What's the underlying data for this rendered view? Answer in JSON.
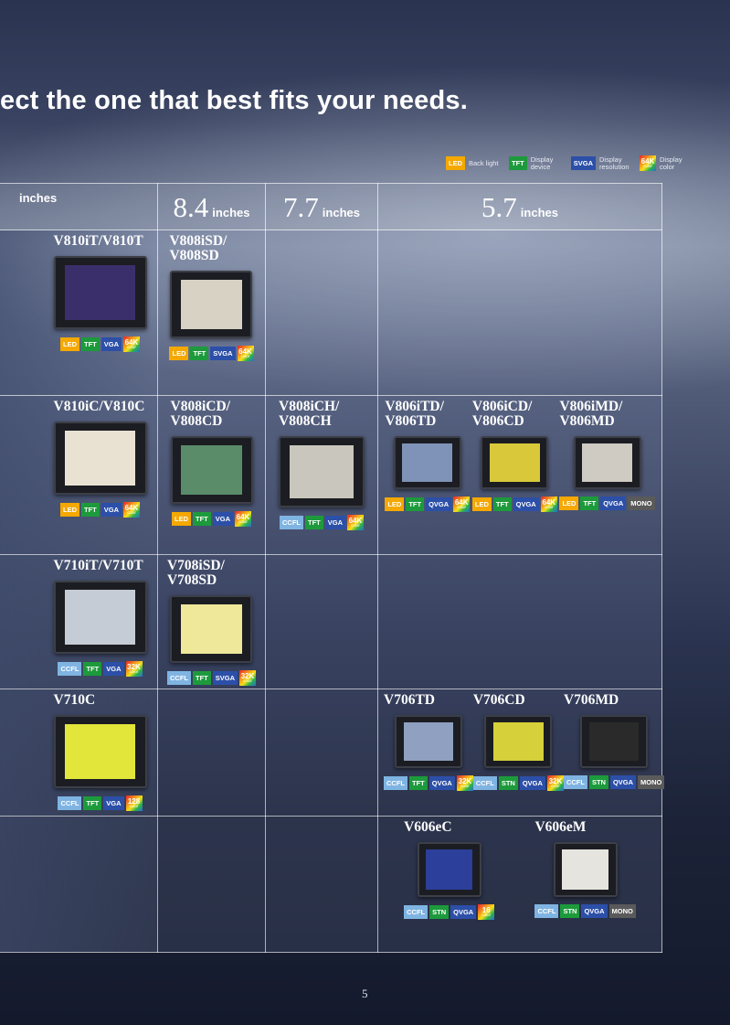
{
  "headline": "ect the one that best fits your needs.",
  "legend": [
    {
      "badge": "LED",
      "label": "Back light",
      "cls": "b-led"
    },
    {
      "badge": "TFT",
      "label": "Display device",
      "cls": "b-tft"
    },
    {
      "badge": "SVGA",
      "label": "Display resolution",
      "cls": "b-res"
    },
    {
      "badge": "64K",
      "sub": "color",
      "label": "Display color",
      "cls": "b-col"
    }
  ],
  "sizes": [
    {
      "num": "",
      "unit": "inches"
    },
    {
      "num": "8.4",
      "unit": "inches"
    },
    {
      "num": "7.7",
      "unit": "inches"
    },
    {
      "num": "5.7",
      "unit": "inches"
    }
  ],
  "rows": [
    {
      "cls": "tall1",
      "cells": [
        [
          {
            "name": "V810iT/V810T",
            "w": 98,
            "h": 76,
            "disp": "#3b2f6b",
            "badges": [
              "LED",
              "TFT",
              "VGA",
              "64K"
            ]
          }
        ],
        [
          {
            "name": "V808iSD/ V808SD",
            "w": 86,
            "h": 70,
            "disp": "#d8d2c4",
            "badges": [
              "LED",
              "TFT",
              "SVGA",
              "64K"
            ]
          }
        ],
        [],
        []
      ]
    },
    {
      "cls": "tall2",
      "cells": [
        [
          {
            "name": "V810iC/V810C",
            "w": 98,
            "h": 76,
            "disp": "#e9e2d3",
            "badges": [
              "LED",
              "TFT",
              "VGA",
              "64K"
            ]
          }
        ],
        [
          {
            "name": "V808iCD/ V808CD",
            "w": 86,
            "h": 70,
            "disp": "#5a8c6a",
            "badges": [
              "LED",
              "TFT",
              "VGA",
              "64K"
            ]
          }
        ],
        [
          {
            "name": "V808iCH/ V808CH",
            "w": 90,
            "h": 74,
            "disp": "#c9c6bd",
            "badges": [
              "CCFL",
              "TFT",
              "VGA",
              "64K"
            ]
          }
        ],
        [
          {
            "name": "V806iTD/ V806TD",
            "w": 70,
            "h": 54,
            "disp": "#7f93b8",
            "badges": [
              "LED",
              "TFT",
              "QVGA",
              "64K"
            ]
          },
          {
            "name": "V806iCD/ V806CD",
            "w": 70,
            "h": 54,
            "disp": "#d8c83a",
            "badges": [
              "LED",
              "TFT",
              "QVGA",
              "64K"
            ]
          },
          {
            "name": "V806iMD/ V806MD",
            "w": 70,
            "h": 54,
            "disp": "#cfcac2",
            "badges": [
              "LED",
              "TFT",
              "QVGA",
              "MONO"
            ]
          }
        ]
      ]
    },
    {
      "cls": "tall3",
      "cells": [
        [
          {
            "name": "V710iT/V710T",
            "w": 98,
            "h": 76,
            "disp": "#c6ccd6",
            "badges": [
              "CCFL",
              "TFT",
              "VGA",
              "32K"
            ]
          }
        ],
        [
          {
            "name": "V708iSD/ V708SD",
            "w": 86,
            "h": 70,
            "disp": "#efe79a",
            "badges": [
              "CCFL",
              "TFT",
              "SVGA",
              "32K"
            ]
          }
        ],
        [],
        []
      ]
    },
    {
      "cls": "tall4",
      "cells": [
        [
          {
            "name": "V710C",
            "w": 98,
            "h": 76,
            "disp": "#e2e63a",
            "badges": [
              "CCFL",
              "TFT",
              "VGA",
              "128"
            ]
          }
        ],
        [],
        [],
        [
          {
            "name": "V706TD",
            "w": 70,
            "h": 54,
            "disp": "#8fa0c0",
            "badges": [
              "CCFL",
              "TFT",
              "QVGA",
              "32K"
            ]
          },
          {
            "name": "V706CD",
            "w": 70,
            "h": 54,
            "disp": "#d6d03a",
            "badges": [
              "CCFL",
              "STN",
              "QVGA",
              "32K"
            ]
          },
          {
            "name": "V706MD",
            "w": 70,
            "h": 54,
            "disp": "#2a2a2a",
            "badges": [
              "CCFL",
              "STN",
              "QVGA",
              "MONO"
            ]
          }
        ]
      ]
    },
    {
      "cls": "tall5",
      "cells": [
        [],
        [],
        [],
        [
          {
            "name": "V606eC",
            "w": 66,
            "h": 56,
            "disp": "#2c3f9a",
            "badges": [
              "CCFL",
              "STN",
              "QVGA",
              "16"
            ]
          },
          {
            "name": "V606eM",
            "w": 66,
            "h": 56,
            "disp": "#e6e4de",
            "badges": [
              "CCFL",
              "STN",
              "QVGA",
              "MONO"
            ]
          }
        ]
      ]
    }
  ],
  "page_number": "5"
}
